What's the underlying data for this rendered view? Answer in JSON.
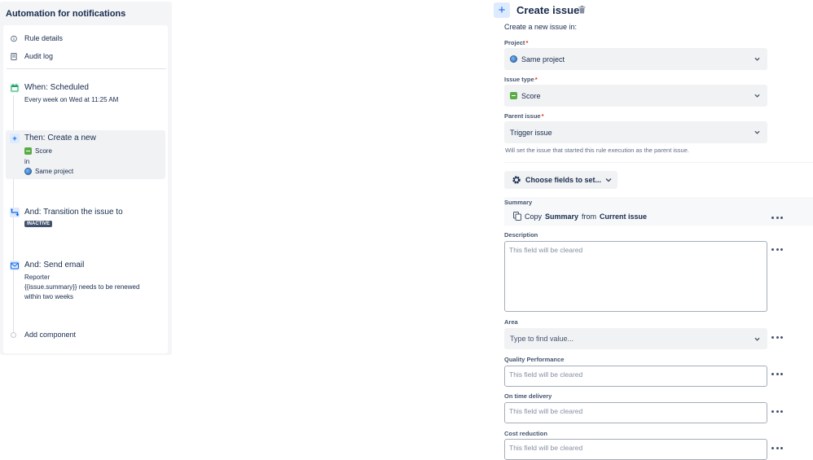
{
  "left": {
    "title": "Automation for notifications",
    "nav": [
      {
        "label": "Rule details",
        "icon": "info-icon"
      },
      {
        "label": "Audit log",
        "icon": "document-icon"
      }
    ],
    "steps": {
      "when": {
        "title": "When: Scheduled",
        "detail": "Every week on Wed at 11:25 AM",
        "icon": "calendar-icon"
      },
      "then": {
        "title": "Then: Create a new",
        "type": "Score",
        "in": "in",
        "project": "Same project",
        "icon": "plus-icon"
      },
      "transition": {
        "title": "And: Transition the issue to",
        "status": "INACTIVE",
        "icon": "transition-icon"
      },
      "email": {
        "title": "And: Send email",
        "to": "Reporter",
        "line1": "{{issue.summary}} needs to be renewed",
        "line2": "within two weeks",
        "icon": "mail-icon"
      }
    },
    "add_component": "Add component"
  },
  "action": {
    "title": "Create issue",
    "subtitle": "Create a new issue in:",
    "project": {
      "label": "Project",
      "value": "Same project"
    },
    "issue_type": {
      "label": "Issue type",
      "value": "Score"
    },
    "parent": {
      "label": "Parent issue",
      "value": "Trigger issue",
      "helper": "Will set the issue that started this rule execution as the parent issue."
    },
    "choose_fields": "Choose fields to set...",
    "summary": {
      "label": "Summary",
      "copy": "Copy",
      "field": "Summary",
      "from": "from",
      "source": "Current issue"
    },
    "description": {
      "label": "Description",
      "placeholder": "This field will be cleared"
    },
    "area": {
      "label": "Area",
      "placeholder": "Type to find value..."
    },
    "quality": {
      "label": "Quality Performance",
      "placeholder": "This field will be cleared"
    },
    "ontime": {
      "label": "On time delivery",
      "placeholder": "This field will be cleared"
    },
    "cost": {
      "label": "Cost reduction",
      "placeholder": "This field will be cleared"
    }
  },
  "colors": {
    "accent": "#0c66e4",
    "required": "#de350b",
    "score_green": "#5aac44",
    "lozenge": "#42526e"
  }
}
